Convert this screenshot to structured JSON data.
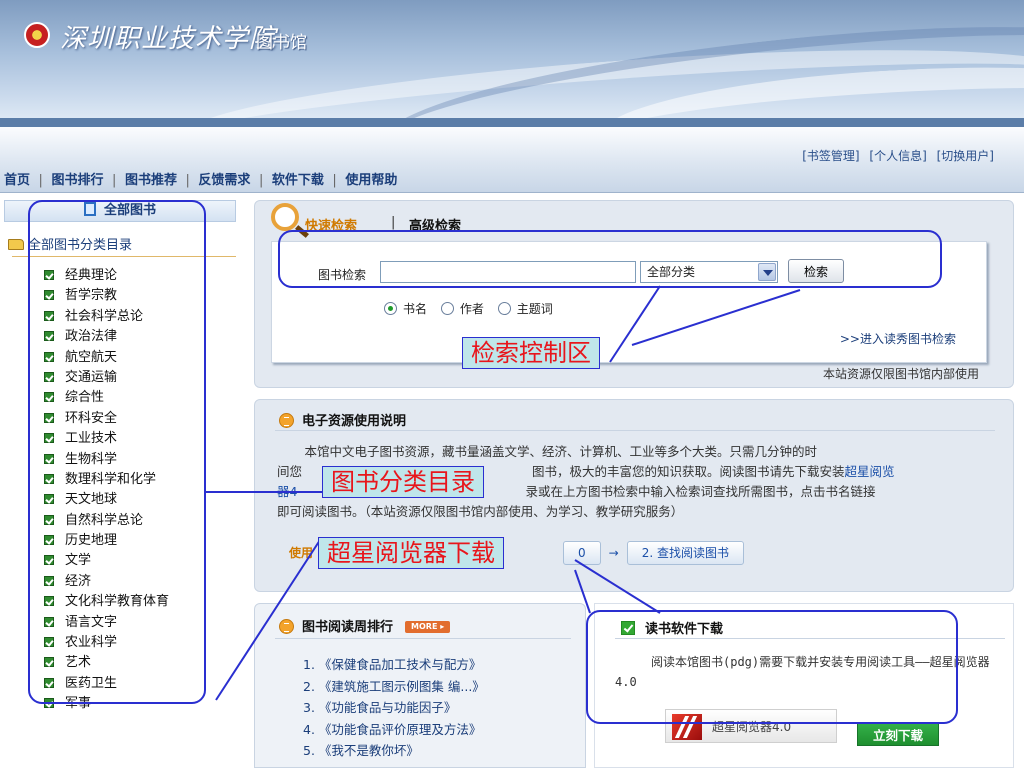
{
  "header": {
    "school_name": "深圳职业技术学院",
    "library_label": "图书馆"
  },
  "nav": {
    "user_links": [
      "[书签管理]",
      "[个人信息]",
      "[切换用户]"
    ],
    "items": [
      "首页",
      "图书排行",
      "图书推荐",
      "反馈需求",
      "软件下载",
      "使用帮助"
    ],
    "separator": "|"
  },
  "sidebar": {
    "title": "全部图书",
    "tree_root": "全部图书分类目录",
    "categories": [
      "经典理论",
      "哲学宗教",
      "社会科学总论",
      "政治法律",
      "航空航天",
      "交通运输",
      "综合性",
      "环科安全",
      "工业技术",
      "生物科学",
      "数理科学和化学",
      "天文地球",
      "自然科学总论",
      "历史地理",
      "文学",
      "经济",
      "文化科学教育体育",
      "语言文字",
      "农业科学",
      "艺术",
      "医药卫生",
      "军事"
    ]
  },
  "search": {
    "tab_quick": "快速检索",
    "tab_separator": "|",
    "tab_advanced": "高级检索",
    "field_label": "图书检索",
    "input_value": "",
    "category_selected": "全部分类",
    "button_label": "检索",
    "radio_options": [
      {
        "label": "书名",
        "checked": true
      },
      {
        "label": "作者",
        "checked": false
      },
      {
        "label": "主题词",
        "checked": false
      }
    ],
    "duxiu_link": ">>进入读秀图书检索",
    "internal_note": "本站资源仅限图书馆内部使用"
  },
  "usage": {
    "title": "电子资源使用说明",
    "para_1": "本馆中文电子图书资源，藏书量涵盖文学、经济、计算机、工业等多个大类。只需几分钟的时",
    "para_2a": "间您",
    "para_2b": "图书，极大的丰富您的知识获取。阅读图书请先下载安装",
    "para_2_link": "超星阅览",
    "para_3a": "器4",
    "para_3b": "录或在上方图书检索中输入检索词查找所需图书，点击书名链接",
    "para_4": "即可阅读图书。（本站资源仅限图书馆内部使用、为学习、教学研究服务）",
    "steps_label": "使用",
    "step_1": "0",
    "step_arrow": "→",
    "step_2": "2. 查找阅读图书"
  },
  "ranking": {
    "title": "图书阅读周排行",
    "more_label": "MORE ▸",
    "items": [
      "1. 《保健食品加工技术与配方》",
      "2. 《建筑施工图示例图集 编...》",
      "3. 《功能食品与功能因子》",
      "4. 《功能食品评价原理及方法》",
      "5. 《我不是教你坏》"
    ]
  },
  "software": {
    "title": "读书软件下载",
    "description": "阅读本馆图书(pdg)需要下载并安装专用阅读工具——超星阅览器4.0",
    "logo_text": "超星阅览器4.0",
    "download_label": "立刻下载"
  },
  "annotations": {
    "search_area": "检索控制区",
    "category_area": "图书分类目录",
    "reader_download": "超星阅览器下载"
  },
  "colors": {
    "annotation_stroke": "#2a2fd0",
    "annotation_text": "#e8161c",
    "annotation_fill": "#bfe6ea",
    "nav_text": "#1b3e7a",
    "accent_orange": "#d07a00"
  }
}
